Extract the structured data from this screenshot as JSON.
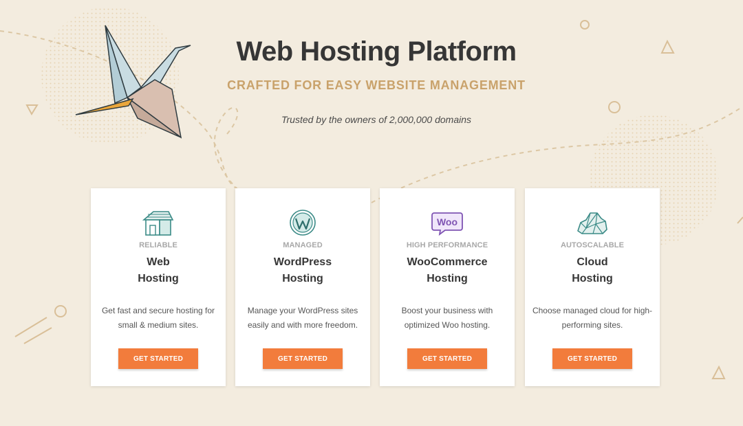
{
  "hero": {
    "title": "Web Hosting Platform",
    "subtitle": "CRAFTED FOR EASY WEBSITE MANAGEMENT",
    "trust_text": "Trusted by the owners of 2,000,000 domains"
  },
  "cards": [
    {
      "icon": "house-icon",
      "tag": "RELIABLE",
      "title_line1": "Web",
      "title_line2": "Hosting",
      "description": "Get fast and secure hosting for small & medium sites.",
      "button_label": "GET STARTED"
    },
    {
      "icon": "wordpress-icon",
      "tag": "MANAGED",
      "title_line1": "WordPress",
      "title_line2": "Hosting",
      "description": "Manage your WordPress sites easily and with more freedom.",
      "button_label": "GET STARTED"
    },
    {
      "icon": "woo-icon",
      "tag": "HIGH PERFORMANCE",
      "title_line1": "WooCommerce",
      "title_line2": "Hosting",
      "description": "Boost your business with optimized Woo hosting.",
      "button_label": "GET STARTED"
    },
    {
      "icon": "cloud-icon",
      "tag": "AUTOSCALABLE",
      "title_line1": "Cloud",
      "title_line2": "Hosting",
      "description": "Choose managed cloud for high-performing sites.",
      "button_label": "GET STARTED"
    }
  ],
  "icons": {
    "woo_text": "Woo"
  },
  "colors": {
    "background": "#f3ecdf",
    "accent_gold": "#c9a26b",
    "button_orange": "#f27c3c",
    "icon_teal": "#3a8a86",
    "icon_purple": "#7f54b3"
  }
}
